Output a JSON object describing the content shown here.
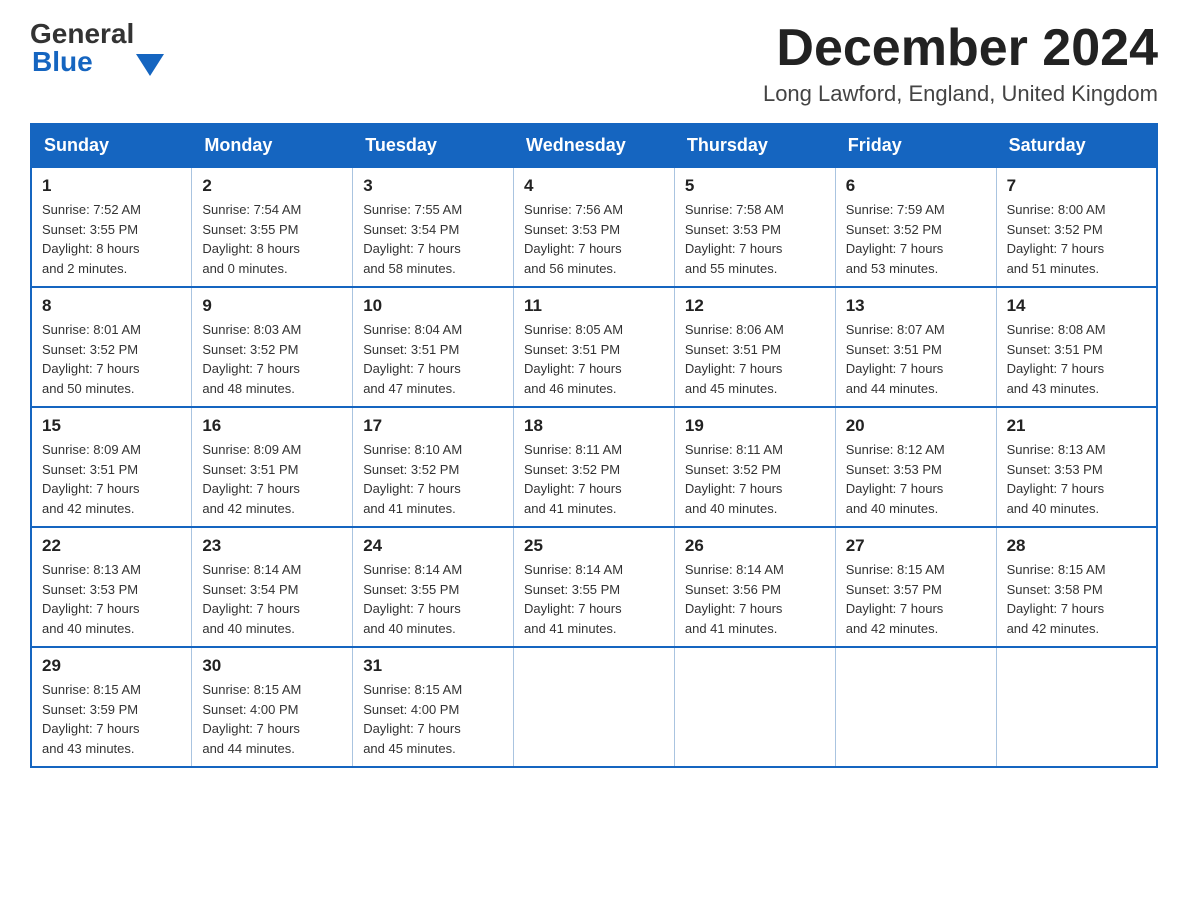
{
  "logo": {
    "text_general": "General",
    "text_blue": "Blue"
  },
  "header": {
    "month_title": "December 2024",
    "location": "Long Lawford, England, United Kingdom"
  },
  "days_of_week": [
    "Sunday",
    "Monday",
    "Tuesday",
    "Wednesday",
    "Thursday",
    "Friday",
    "Saturday"
  ],
  "weeks": [
    [
      {
        "day": "1",
        "sunrise": "7:52 AM",
        "sunset": "3:55 PM",
        "daylight": "8 hours and 2 minutes."
      },
      {
        "day": "2",
        "sunrise": "7:54 AM",
        "sunset": "3:55 PM",
        "daylight": "8 hours and 0 minutes."
      },
      {
        "day": "3",
        "sunrise": "7:55 AM",
        "sunset": "3:54 PM",
        "daylight": "7 hours and 58 minutes."
      },
      {
        "day": "4",
        "sunrise": "7:56 AM",
        "sunset": "3:53 PM",
        "daylight": "7 hours and 56 minutes."
      },
      {
        "day": "5",
        "sunrise": "7:58 AM",
        "sunset": "3:53 PM",
        "daylight": "7 hours and 55 minutes."
      },
      {
        "day": "6",
        "sunrise": "7:59 AM",
        "sunset": "3:52 PM",
        "daylight": "7 hours and 53 minutes."
      },
      {
        "day": "7",
        "sunrise": "8:00 AM",
        "sunset": "3:52 PM",
        "daylight": "7 hours and 51 minutes."
      }
    ],
    [
      {
        "day": "8",
        "sunrise": "8:01 AM",
        "sunset": "3:52 PM",
        "daylight": "7 hours and 50 minutes."
      },
      {
        "day": "9",
        "sunrise": "8:03 AM",
        "sunset": "3:52 PM",
        "daylight": "7 hours and 48 minutes."
      },
      {
        "day": "10",
        "sunrise": "8:04 AM",
        "sunset": "3:51 PM",
        "daylight": "7 hours and 47 minutes."
      },
      {
        "day": "11",
        "sunrise": "8:05 AM",
        "sunset": "3:51 PM",
        "daylight": "7 hours and 46 minutes."
      },
      {
        "day": "12",
        "sunrise": "8:06 AM",
        "sunset": "3:51 PM",
        "daylight": "7 hours and 45 minutes."
      },
      {
        "day": "13",
        "sunrise": "8:07 AM",
        "sunset": "3:51 PM",
        "daylight": "7 hours and 44 minutes."
      },
      {
        "day": "14",
        "sunrise": "8:08 AM",
        "sunset": "3:51 PM",
        "daylight": "7 hours and 43 minutes."
      }
    ],
    [
      {
        "day": "15",
        "sunrise": "8:09 AM",
        "sunset": "3:51 PM",
        "daylight": "7 hours and 42 minutes."
      },
      {
        "day": "16",
        "sunrise": "8:09 AM",
        "sunset": "3:51 PM",
        "daylight": "7 hours and 42 minutes."
      },
      {
        "day": "17",
        "sunrise": "8:10 AM",
        "sunset": "3:52 PM",
        "daylight": "7 hours and 41 minutes."
      },
      {
        "day": "18",
        "sunrise": "8:11 AM",
        "sunset": "3:52 PM",
        "daylight": "7 hours and 41 minutes."
      },
      {
        "day": "19",
        "sunrise": "8:11 AM",
        "sunset": "3:52 PM",
        "daylight": "7 hours and 40 minutes."
      },
      {
        "day": "20",
        "sunrise": "8:12 AM",
        "sunset": "3:53 PM",
        "daylight": "7 hours and 40 minutes."
      },
      {
        "day": "21",
        "sunrise": "8:13 AM",
        "sunset": "3:53 PM",
        "daylight": "7 hours and 40 minutes."
      }
    ],
    [
      {
        "day": "22",
        "sunrise": "8:13 AM",
        "sunset": "3:53 PM",
        "daylight": "7 hours and 40 minutes."
      },
      {
        "day": "23",
        "sunrise": "8:14 AM",
        "sunset": "3:54 PM",
        "daylight": "7 hours and 40 minutes."
      },
      {
        "day": "24",
        "sunrise": "8:14 AM",
        "sunset": "3:55 PM",
        "daylight": "7 hours and 40 minutes."
      },
      {
        "day": "25",
        "sunrise": "8:14 AM",
        "sunset": "3:55 PM",
        "daylight": "7 hours and 41 minutes."
      },
      {
        "day": "26",
        "sunrise": "8:14 AM",
        "sunset": "3:56 PM",
        "daylight": "7 hours and 41 minutes."
      },
      {
        "day": "27",
        "sunrise": "8:15 AM",
        "sunset": "3:57 PM",
        "daylight": "7 hours and 42 minutes."
      },
      {
        "day": "28",
        "sunrise": "8:15 AM",
        "sunset": "3:58 PM",
        "daylight": "7 hours and 42 minutes."
      }
    ],
    [
      {
        "day": "29",
        "sunrise": "8:15 AM",
        "sunset": "3:59 PM",
        "daylight": "7 hours and 43 minutes."
      },
      {
        "day": "30",
        "sunrise": "8:15 AM",
        "sunset": "4:00 PM",
        "daylight": "7 hours and 44 minutes."
      },
      {
        "day": "31",
        "sunrise": "8:15 AM",
        "sunset": "4:00 PM",
        "daylight": "7 hours and 45 minutes."
      },
      null,
      null,
      null,
      null
    ]
  ],
  "labels": {
    "sunrise": "Sunrise:",
    "sunset": "Sunset:",
    "daylight": "Daylight:"
  },
  "colors": {
    "header_bg": "#1565c0",
    "header_text": "#ffffff",
    "border": "#aac4e0",
    "accent": "#1565c0"
  }
}
